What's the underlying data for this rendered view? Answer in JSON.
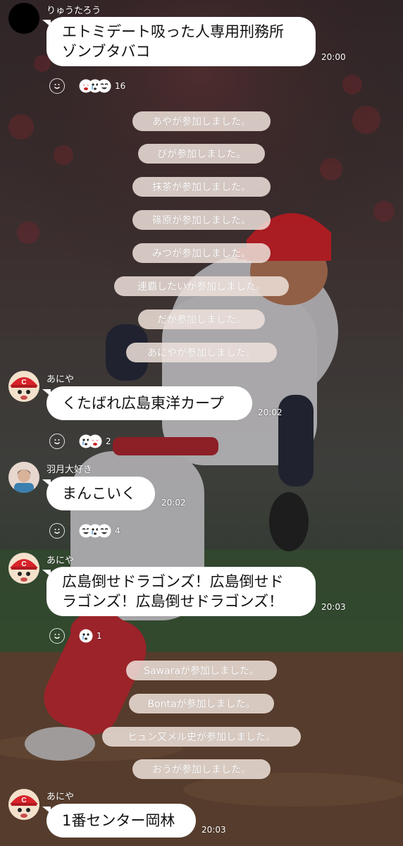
{
  "messages": [
    {
      "sender": "りゅうたろう",
      "text": "エトミデート吸った人専用刑務所\nゾンブタバコ",
      "time": "20:00",
      "reaction_count": "16"
    },
    {
      "sender": "あにや",
      "text": "くたばれ広島東洋カープ",
      "time": "20:02",
      "reaction_count": "2"
    },
    {
      "sender": "羽月大好き",
      "text": "まんこいく",
      "time": "20:02",
      "reaction_count": "4"
    },
    {
      "sender": "あにや",
      "text": "広島倒せドラゴンズ！広島倒せド\nラゴンズ！広島倒せドラゴンズ！",
      "time": "20:03",
      "reaction_count": "1"
    },
    {
      "sender": "あにや",
      "text": "1番センター岡林",
      "time": "20:03"
    }
  ],
  "system_notices": [
    "あやが参加しました。",
    "ぴが参加しました。",
    "抹茶が参加しました。",
    "篠原が参加しました。",
    "みつが参加しました。",
    "連覇したいが参加しました。",
    "だが参加しました。",
    "あにやが参加しました。",
    "Sawaraが参加しました。",
    "Bontaが参加しました。",
    "ヒュン又メル史が参加しました。",
    "おうが参加しました。"
  ],
  "icons": {
    "react_button": "smiley-outline-icon",
    "reactions": [
      "heart-eyes-sticker",
      "tear-face-sticker",
      "laughing-face-sticker"
    ]
  },
  "colors": {
    "bubble": "#ffffff",
    "notice_pill": "#eee2da",
    "cap_red": "#d8232a"
  }
}
